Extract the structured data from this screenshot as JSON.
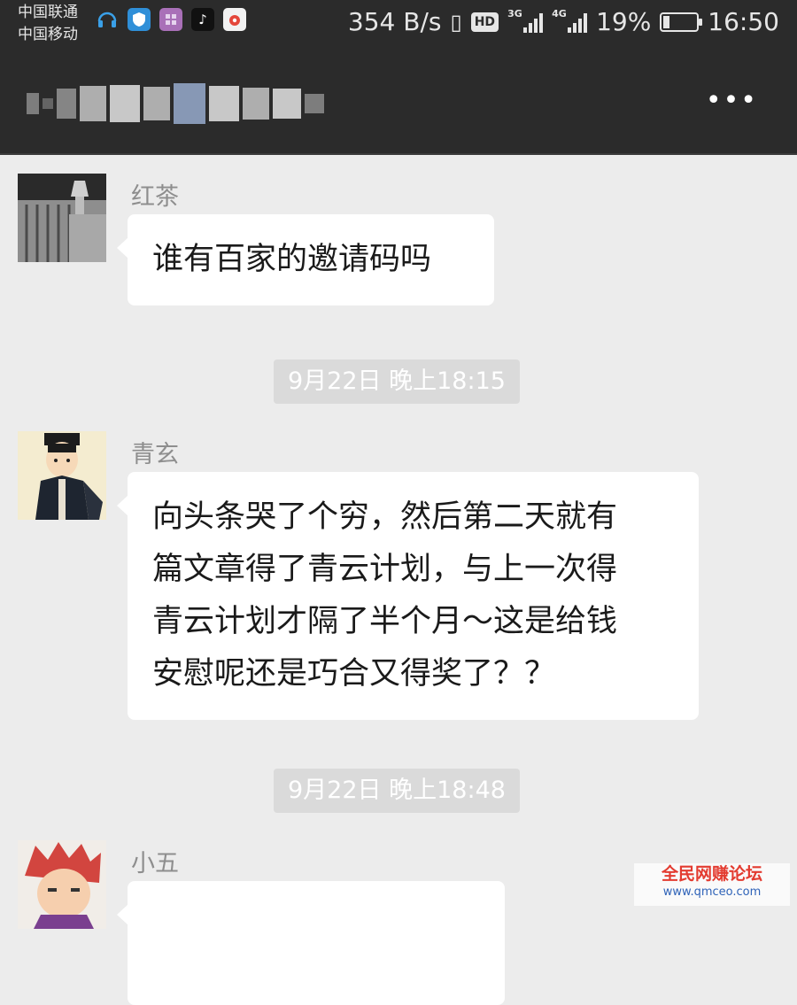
{
  "status_bar": {
    "carrier_1": "中国联通",
    "carrier_2": "中国移动",
    "speed": "354 B/s",
    "hd": "HD",
    "net_1": "3G",
    "net_2": "4G",
    "battery": "19%",
    "battery_level": 0.19,
    "time": "16:50"
  },
  "title_bar": {
    "more_label": "•••"
  },
  "messages": [
    {
      "sender": "红茶",
      "lines": [
        "谁有百家的邀请码吗"
      ]
    },
    {
      "sender": "青玄",
      "lines": [
        "向头条哭了个穷，然后第二天就有",
        "篇文章得了青云计划，与上一次得",
        "青云计划才隔了半个月～这是给钱",
        "安慰呢还是巧合又得奖了？？"
      ]
    },
    {
      "sender": "小五",
      "lines": [
        ""
      ]
    }
  ],
  "timestamps": [
    "9月22日 晚上18:15",
    "9月22日 晚上18:48"
  ],
  "watermark": {
    "name": "全民网赚论坛",
    "url": "www.qmceo.com"
  },
  "colors": {
    "bar_bg": "#2b2b2b",
    "chat_bg": "#ececec",
    "bubble": "#ffffff",
    "time_pill": "#dadada"
  }
}
